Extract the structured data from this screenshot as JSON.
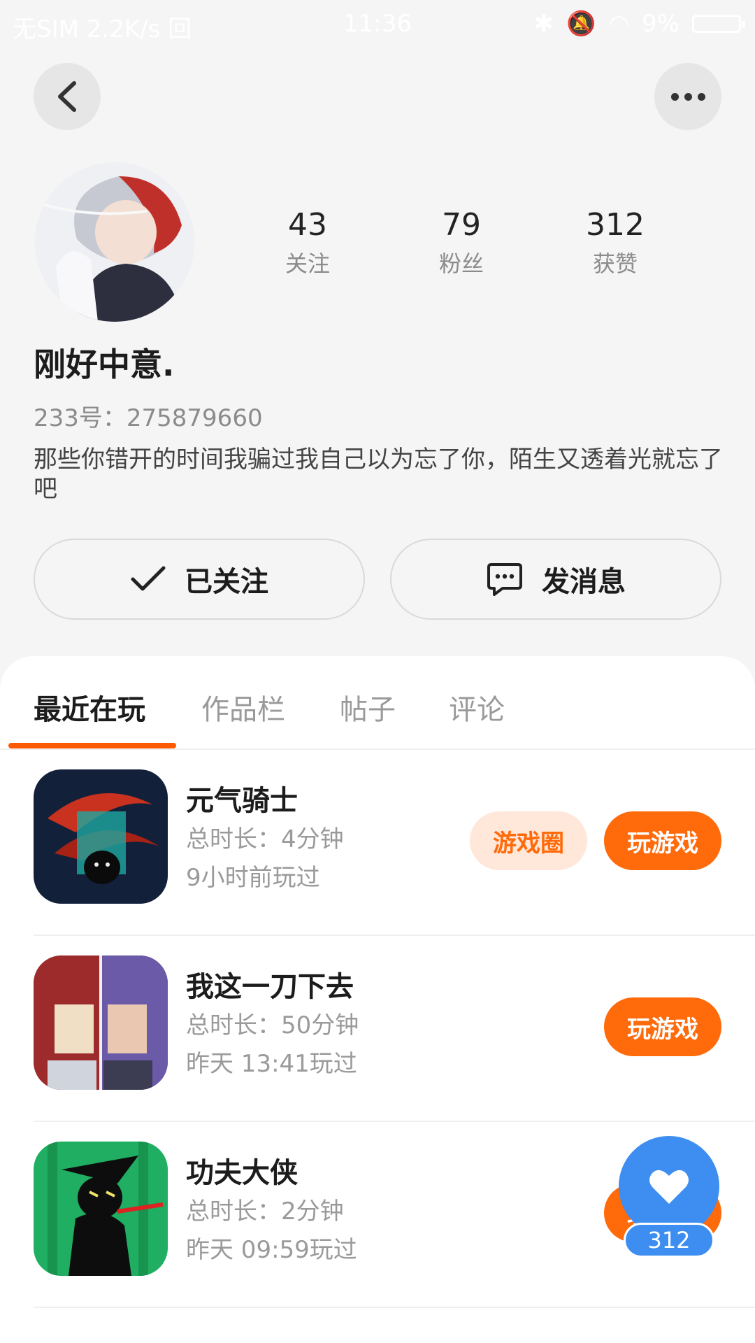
{
  "status_bar": {
    "left": "无SIM 2.2K/s 回",
    "time": "11:36",
    "battery": "9%"
  },
  "profile": {
    "stats": [
      {
        "value": "43",
        "label": "关注"
      },
      {
        "value": "79",
        "label": "粉丝"
      },
      {
        "value": "312",
        "label": "获赞"
      }
    ],
    "nickname": "刚好中意.",
    "id_text": "233号：275879660",
    "bio": "那些你错开的时间我骗过我自己以为忘了你，陌生又透着光就忘了吧"
  },
  "actions": {
    "followed_label": "已关注",
    "message_label": "发消息"
  },
  "tabs": [
    "最近在玩",
    "作品栏",
    "帖子",
    "评论"
  ],
  "games": [
    {
      "name": "元气骑士",
      "duration": "总时长：4分钟",
      "last_played": "9小时前玩过",
      "circle_label": "游戏圈",
      "play_label": "玩游戏"
    },
    {
      "name": "我这一刀下去",
      "duration": "总时长：50分钟",
      "last_played": "昨天 13:41玩过",
      "play_label": "玩游戏"
    },
    {
      "name": "功夫大侠",
      "duration": "总时长：2分钟",
      "last_played": "昨天 09:59玩过",
      "play_label": "玩游戏"
    }
  ],
  "like_badge": {
    "count": "312"
  }
}
